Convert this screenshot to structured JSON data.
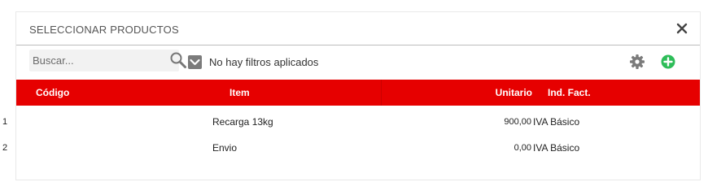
{
  "dialog": {
    "title": "SELECCIONAR PRODUCTOS",
    "close_icon": "close-icon"
  },
  "toolbar": {
    "search_placeholder": "Buscar...",
    "search_icon": "search-icon",
    "filter_checked": true,
    "filter_text": "No hay filtros aplicados",
    "settings_icon": "gear-icon",
    "add_icon": "add-circle-icon"
  },
  "table": {
    "columns": [
      "Código",
      "Item",
      "Unitario",
      "Ind. Fact."
    ],
    "rows": [
      {
        "code": "1",
        "item": "Recarga 13kg",
        "unit": "900,00",
        "ind": "IVA Básico"
      },
      {
        "code": "2",
        "item": "Envio",
        "unit": "0,00",
        "ind": "IVA Básico"
      }
    ]
  },
  "colors": {
    "header_bg": "#e60000",
    "accent_green": "#2ebd59",
    "icon_gray": "#7b7b7b"
  }
}
